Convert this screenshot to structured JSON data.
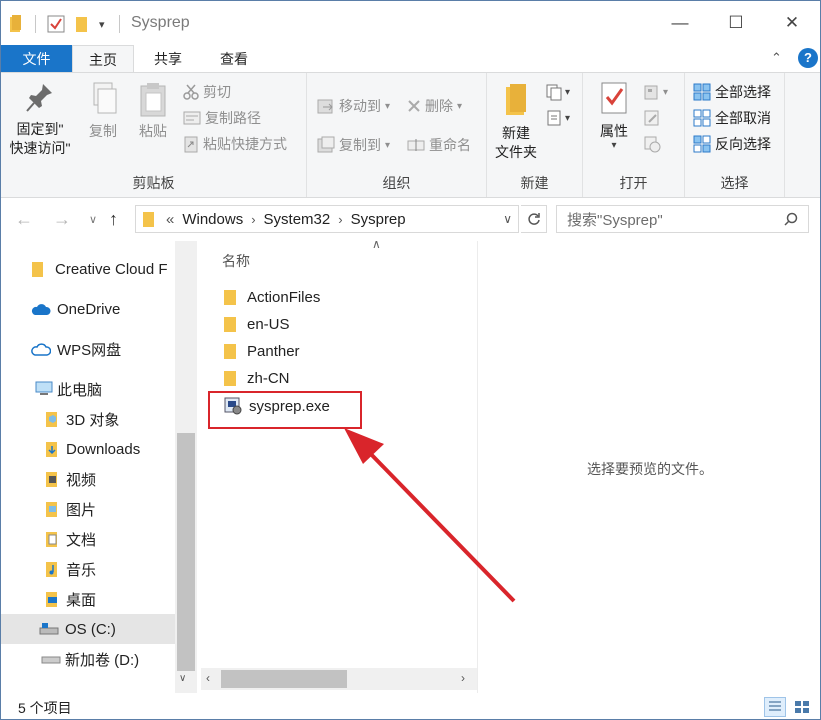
{
  "window": {
    "title": "Sysprep",
    "controls": {
      "minimize": "—",
      "maximize": "☐",
      "close": "✕"
    }
  },
  "ribbon_tabs": [
    "文件",
    "主页",
    "共享",
    "查看"
  ],
  "ribbon": {
    "clipboard": {
      "pin_label_1": "固定到\"",
      "pin_label_2": "快速访问\"",
      "copy": "复制",
      "paste": "粘贴",
      "cut": "剪切",
      "copy_path": "复制路径",
      "paste_shortcut": "粘贴快捷方式",
      "group": "剪贴板"
    },
    "organize": {
      "move_to": "移动到",
      "copy_to": "复制到",
      "delete": "删除",
      "rename": "重命名",
      "group": "组织"
    },
    "new": {
      "new_folder_1": "新建",
      "new_folder_2": "文件夹",
      "group": "新建"
    },
    "open": {
      "properties": "属性",
      "group": "打开"
    },
    "select": {
      "select_all": "全部选择",
      "select_none": "全部取消",
      "invert": "反向选择",
      "group": "选择"
    }
  },
  "address": {
    "overflow": "«",
    "crumbs": [
      "Windows",
      "System32",
      "Sysprep"
    ],
    "search_placeholder": "搜索\"Sysprep\""
  },
  "nav": [
    {
      "label": "Creative Cloud F",
      "icon": "folder-icon"
    },
    {
      "label": "OneDrive",
      "icon": "cloud-icon"
    },
    {
      "label": "WPS网盘",
      "icon": "cloud-outline-icon"
    },
    {
      "label": "此电脑",
      "icon": "computer-icon"
    },
    {
      "label": "3D 对象",
      "icon": "3d-objects-icon"
    },
    {
      "label": "Downloads",
      "icon": "downloads-icon"
    },
    {
      "label": "视频",
      "icon": "video-icon"
    },
    {
      "label": "图片",
      "icon": "pictures-icon"
    },
    {
      "label": "文档",
      "icon": "documents-icon"
    },
    {
      "label": "音乐",
      "icon": "music-icon"
    },
    {
      "label": "桌面",
      "icon": "desktop-icon"
    },
    {
      "label": "OS (C:)",
      "icon": "os-drive-icon"
    },
    {
      "label": "新加卷 (D:)",
      "icon": "drive-icon"
    }
  ],
  "files": {
    "column_name": "名称",
    "items": [
      {
        "name": "ActionFiles",
        "type": "folder"
      },
      {
        "name": "en-US",
        "type": "folder"
      },
      {
        "name": "Panther",
        "type": "folder"
      },
      {
        "name": "zh-CN",
        "type": "folder"
      },
      {
        "name": "sysprep.exe",
        "type": "exe"
      }
    ]
  },
  "preview_text": "选择要预览的文件。",
  "status": {
    "count": "5 个项目"
  },
  "colors": {
    "accent": "#1a75c9",
    "folder": "#f4c34a",
    "highlight": "#d9252b"
  }
}
